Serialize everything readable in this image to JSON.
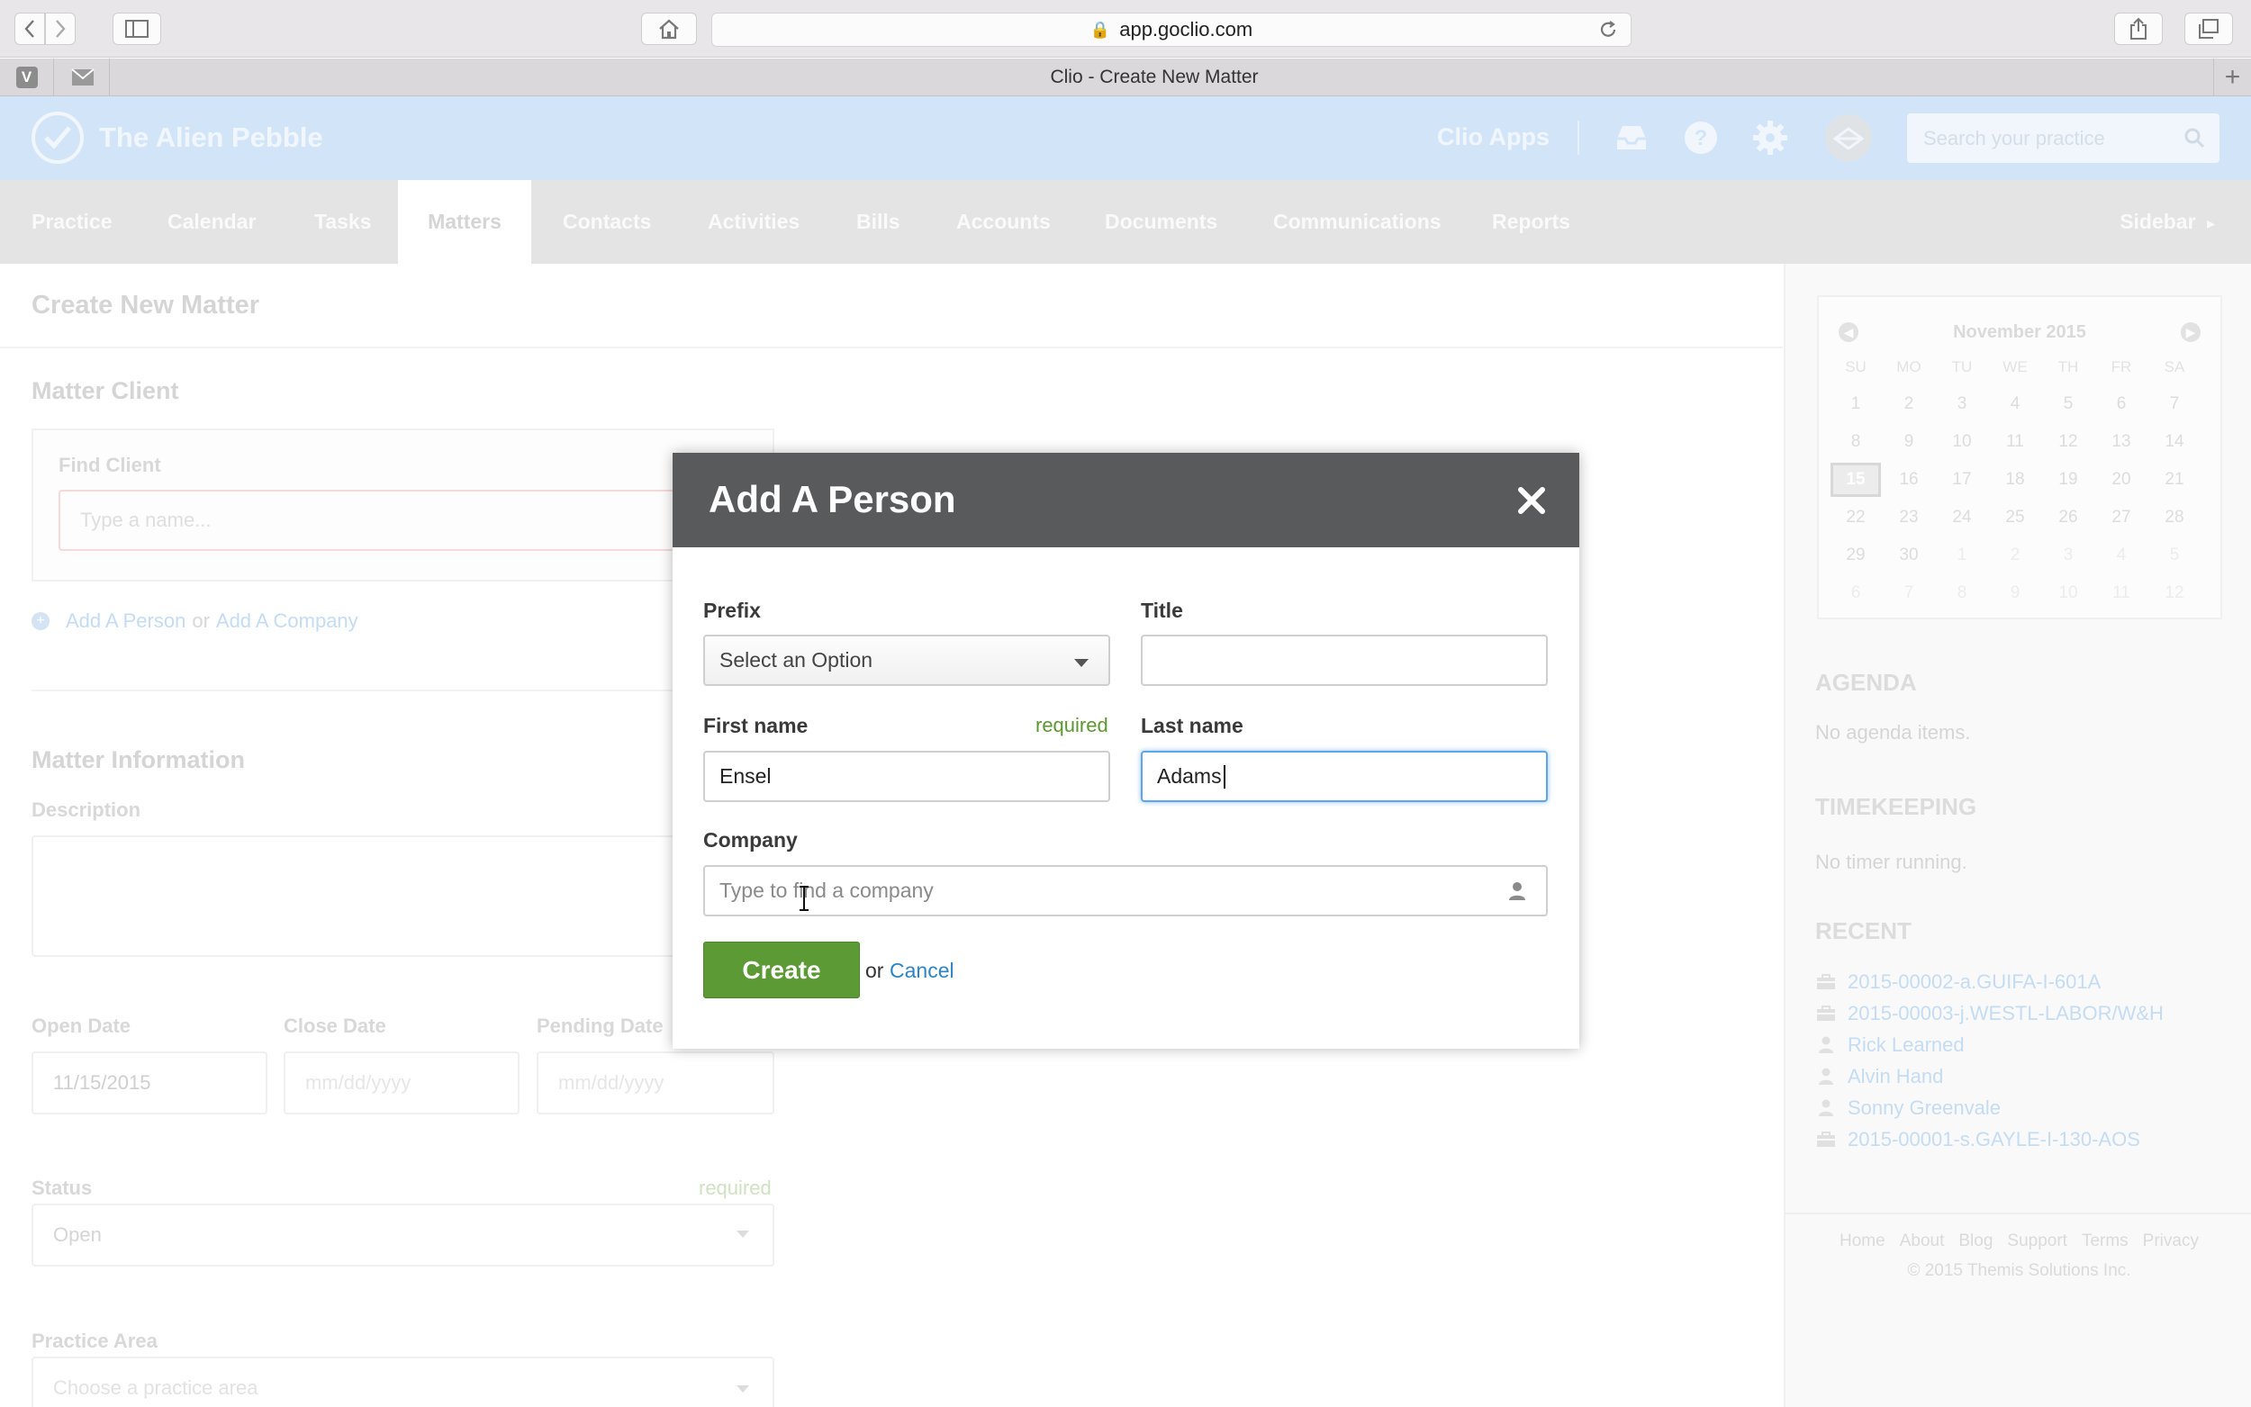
{
  "browser": {
    "url": "app.goclio.com",
    "tab_title": "Clio - Create New Matter",
    "pinned_tab_letter": "V"
  },
  "header": {
    "firm_name": "The Alien Pebble",
    "apps_label": "Clio Apps",
    "search_placeholder": "Search your practice"
  },
  "nav": {
    "items": [
      "Practice",
      "Calendar",
      "Tasks",
      "Matters",
      "Contacts",
      "Activities",
      "Bills",
      "Accounts",
      "Documents",
      "Communications",
      "Reports"
    ],
    "active": "Matters",
    "sidebar_label": "Sidebar"
  },
  "page": {
    "title": "Create New Matter",
    "matter_client_heading": "Matter Client",
    "find_client_label": "Find Client",
    "find_client_placeholder": "Type a name...",
    "add_person_link": "Add A Person",
    "or_text": "or",
    "add_company_link": "Add A Company",
    "matter_info_heading": "Matter Information",
    "description_label": "Description",
    "open_date_label": "Open Date",
    "open_date_value": "11/15/2015",
    "close_date_label": "Close Date",
    "close_date_placeholder": "mm/dd/yyyy",
    "pending_date_label": "Pending Date",
    "pending_date_placeholder": "mm/dd/yyyy",
    "status_label": "Status",
    "status_required": "required",
    "status_value": "Open",
    "practice_area_label": "Practice Area",
    "practice_area_placeholder": "Choose a practice area"
  },
  "sidebar": {
    "calendar": {
      "month": "November 2015",
      "dow": [
        "SU",
        "MO",
        "TU",
        "WE",
        "TH",
        "FR",
        "SA"
      ],
      "weeks": [
        [
          "1",
          "2",
          "3",
          "4",
          "5",
          "6",
          "7"
        ],
        [
          "8",
          "9",
          "10",
          "11",
          "12",
          "13",
          "14"
        ],
        [
          "15",
          "16",
          "17",
          "18",
          "19",
          "20",
          "21"
        ],
        [
          "22",
          "23",
          "24",
          "25",
          "26",
          "27",
          "28"
        ],
        [
          "29",
          "30",
          "1",
          "2",
          "3",
          "4",
          "5"
        ],
        [
          "6",
          "7",
          "8",
          "9",
          "10",
          "11",
          "12"
        ]
      ],
      "today": "15"
    },
    "agenda_heading": "AGENDA",
    "agenda_text": "No agenda items.",
    "timekeeping_heading": "TIMEKEEPING",
    "timekeeping_text": "No timer running.",
    "recent_heading": "RECENT",
    "recent": [
      {
        "label": "2015-00002-a.GUIFA-I-601A",
        "icon": "briefcase-icon"
      },
      {
        "label": "2015-00003-j.WESTL-LABOR/W&H",
        "icon": "briefcase-icon"
      },
      {
        "label": "Rick Learned",
        "icon": "person-icon"
      },
      {
        "label": "Alvin Hand",
        "icon": "person-icon"
      },
      {
        "label": "Sonny Greenvale",
        "icon": "person-icon"
      },
      {
        "label": "2015-00001-s.GAYLE-I-130-AOS",
        "icon": "briefcase-icon"
      }
    ],
    "footer_links": [
      "Home",
      "About",
      "Blog",
      "Support",
      "Terms",
      "Privacy"
    ],
    "copyright": "© 2015 Themis Solutions Inc."
  },
  "modal": {
    "title": "Add A Person",
    "prefix_label": "Prefix",
    "prefix_value": "Select an Option",
    "title_label": "Title",
    "title_value": "",
    "first_name_label": "First name",
    "required_text": "required",
    "first_name_value": "Ensel",
    "last_name_label": "Last name",
    "last_name_value": "Adams",
    "company_label": "Company",
    "company_placeholder": "Type to find a company",
    "create_label": "Create",
    "or_text": "or",
    "cancel_label": "Cancel"
  },
  "colors": {
    "header_bg": "#d2e5f8",
    "modal_header": "#595a5c",
    "create_green": "#5b9a34",
    "link_blue": "#2e84c8",
    "required_green": "#5d9732"
  }
}
